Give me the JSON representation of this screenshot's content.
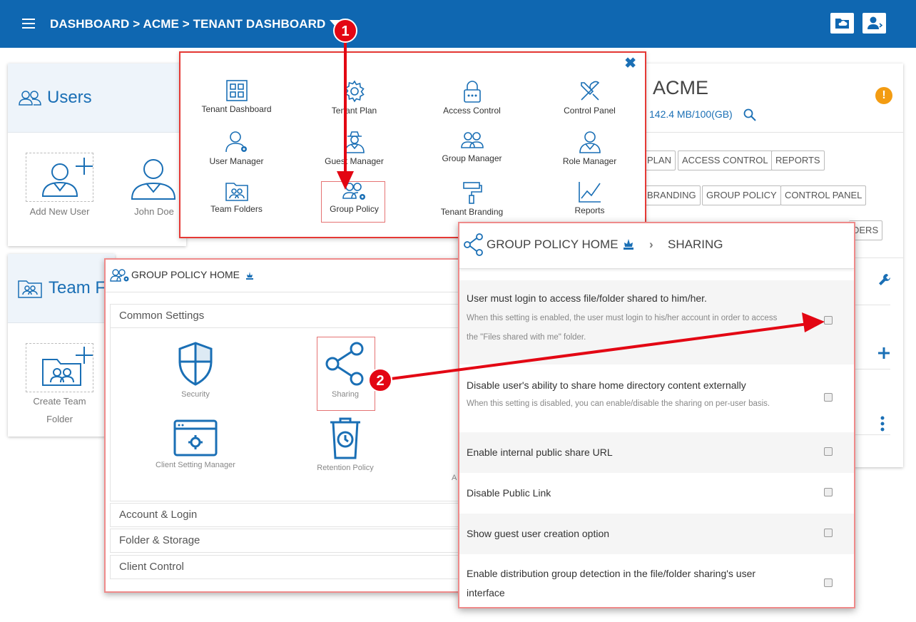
{
  "topbar": {
    "breadcrumb": "DASHBOARD > ACME > TENANT DASHBOARD",
    "icons": [
      "menu-icon",
      "cloud-folder-icon",
      "user-switch-icon"
    ]
  },
  "users_panel": {
    "title": "Users",
    "add_new_user": "Add New User",
    "john_doe": "John Doe"
  },
  "team_panel": {
    "title": "Team F",
    "create_team_line1": "Create Team",
    "create_team_line2": "Folder"
  },
  "acme": {
    "title": "ACME",
    "storage": "142.4 MB/100(GB)",
    "tags": [
      "PLAN",
      "ACCESS CONTROL",
      "REPORTS",
      "BRANDING",
      "GROUP POLICY",
      "CONTROL PANEL",
      "DERS"
    ]
  },
  "launcher": {
    "apps": [
      {
        "label": "Tenant Dashboard",
        "icon": "grid-icon"
      },
      {
        "label": "Tenant Plan",
        "icon": "gear-icon"
      },
      {
        "label": "Access Control",
        "icon": "lock-icon"
      },
      {
        "label": "Control Panel",
        "icon": "tools-icon"
      },
      {
        "label": "User Manager",
        "icon": "user-gear-icon"
      },
      {
        "label": "Guest Manager",
        "icon": "guest-icon"
      },
      {
        "label": "Group Manager",
        "icon": "group-icon"
      },
      {
        "label": "Role Manager",
        "icon": "role-icon"
      },
      {
        "label": "Team Folders",
        "icon": "team-folder-icon"
      },
      {
        "label": "Group Policy",
        "icon": "group-gear-icon"
      },
      {
        "label": "Tenant Branding",
        "icon": "paint-roller-icon"
      },
      {
        "label": "Reports",
        "icon": "chart-icon"
      }
    ]
  },
  "group_policy": {
    "title": "GROUP POLICY HOME",
    "sections": [
      "Common Settings",
      "Account & Login",
      "Folder & Storage",
      "Client Control"
    ],
    "items": [
      "Security",
      "Sharing",
      "Client Setting Manager",
      "Retention Policy",
      "A"
    ]
  },
  "sharing": {
    "title": "GROUP POLICY HOME",
    "subtitle": "SHARING",
    "settings": [
      {
        "label": "User must login to access file/folder shared to him/her.",
        "desc1": "When this setting is enabled, the user must login to his/her account in order to access",
        "desc2": "the \"Files shared with me\" folder."
      },
      {
        "label": "Disable user's ability to share home directory content externally",
        "desc1": "When this setting is disabled, you can enable/disable the sharing on per-user basis."
      },
      {
        "label": "Enable internal public share URL"
      },
      {
        "label": "Disable Public Link"
      },
      {
        "label": "Show guest user creation option"
      },
      {
        "label": "Enable distribution group detection in the file/folder sharing's user",
        "label2": "interface"
      }
    ]
  },
  "annotations": {
    "step1": "1",
    "step2": "2"
  },
  "colors": {
    "brand": "#0f67b1",
    "highlight": "#e53935",
    "warning": "#f39c12"
  }
}
